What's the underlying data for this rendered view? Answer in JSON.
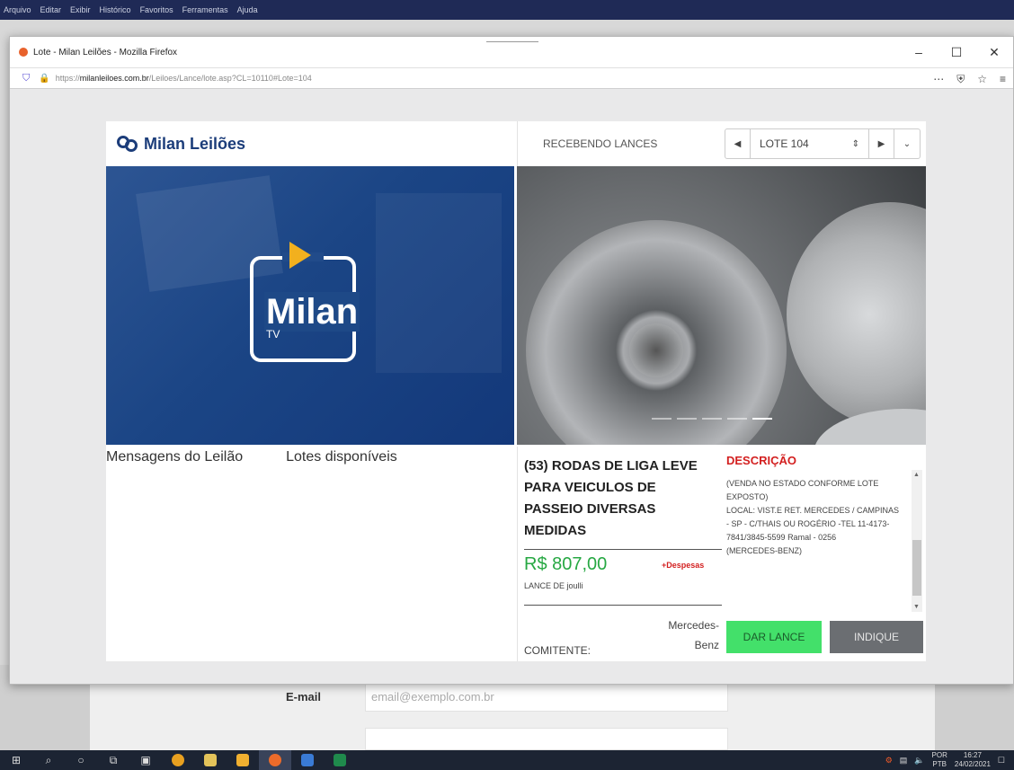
{
  "app_menubar": [
    "Arquivo",
    "Editar",
    "Exibir",
    "Histórico",
    "Favoritos",
    "Ferramentas",
    "Ajuda"
  ],
  "browser": {
    "window_title": "Lote - Milan Leilões - Mozilla Firefox",
    "url_prefix": "https://",
    "url_domain": "milanleiloes.com.br",
    "url_path": "/Leiloes/Lance/lote.asp?CL=10110#Lote=104",
    "more_icon": "⋯",
    "pocket_icon": "pocket-icon",
    "star_icon": "star-icon",
    "menu_icon": "menu-icon"
  },
  "header": {
    "logo_text": "Milan Leilões",
    "status": "RECEBENDO LANCES",
    "lot_selected": "LOTE 104"
  },
  "video_panel": {
    "brand": "Milan",
    "sub": "TV"
  },
  "tabs": [
    "Mensagens do Leilão",
    "Lotes disponíveis"
  ],
  "lot": {
    "title": "(53) RODAS DE LIGA LEVE PARA VEICULOS DE PASSEIO DIVERSAS MEDIDAS",
    "price": "R$ 807,00",
    "expenses": "+Despesas",
    "bidder": "LANCE DE joulli",
    "consignor_label": "COMITENTE:",
    "consignor_value": "Mercedes-Benz"
  },
  "description": {
    "title": "DESCRIÇÃO",
    "text": "(VENDA NO ESTADO CONFORME LOTE EXPOSTO)\nLOCAL: VIST.E RET. MERCEDES / CAMPINAS - SP - C/THAIS OU ROGÉRIO -TEL 11-4173-7841/3845-5599 Ramal - 0256\n(MERCEDES-BENZ)"
  },
  "buttons": {
    "bid": "DAR LANCE",
    "share": "INDIQUE"
  },
  "background_form": {
    "email_label": "E-mail",
    "email_placeholder": "email@exemplo.com.br"
  },
  "taskbar": {
    "lang": "POR",
    "lang_sub": "PTB",
    "time": "16:27",
    "date": "24/02/2021"
  },
  "colors": {
    "brand_blue": "#1c3d7a",
    "price_green": "#27a843",
    "alert_red": "#d32020",
    "bid_button": "#43e06a",
    "share_button": "#6b6e72"
  }
}
